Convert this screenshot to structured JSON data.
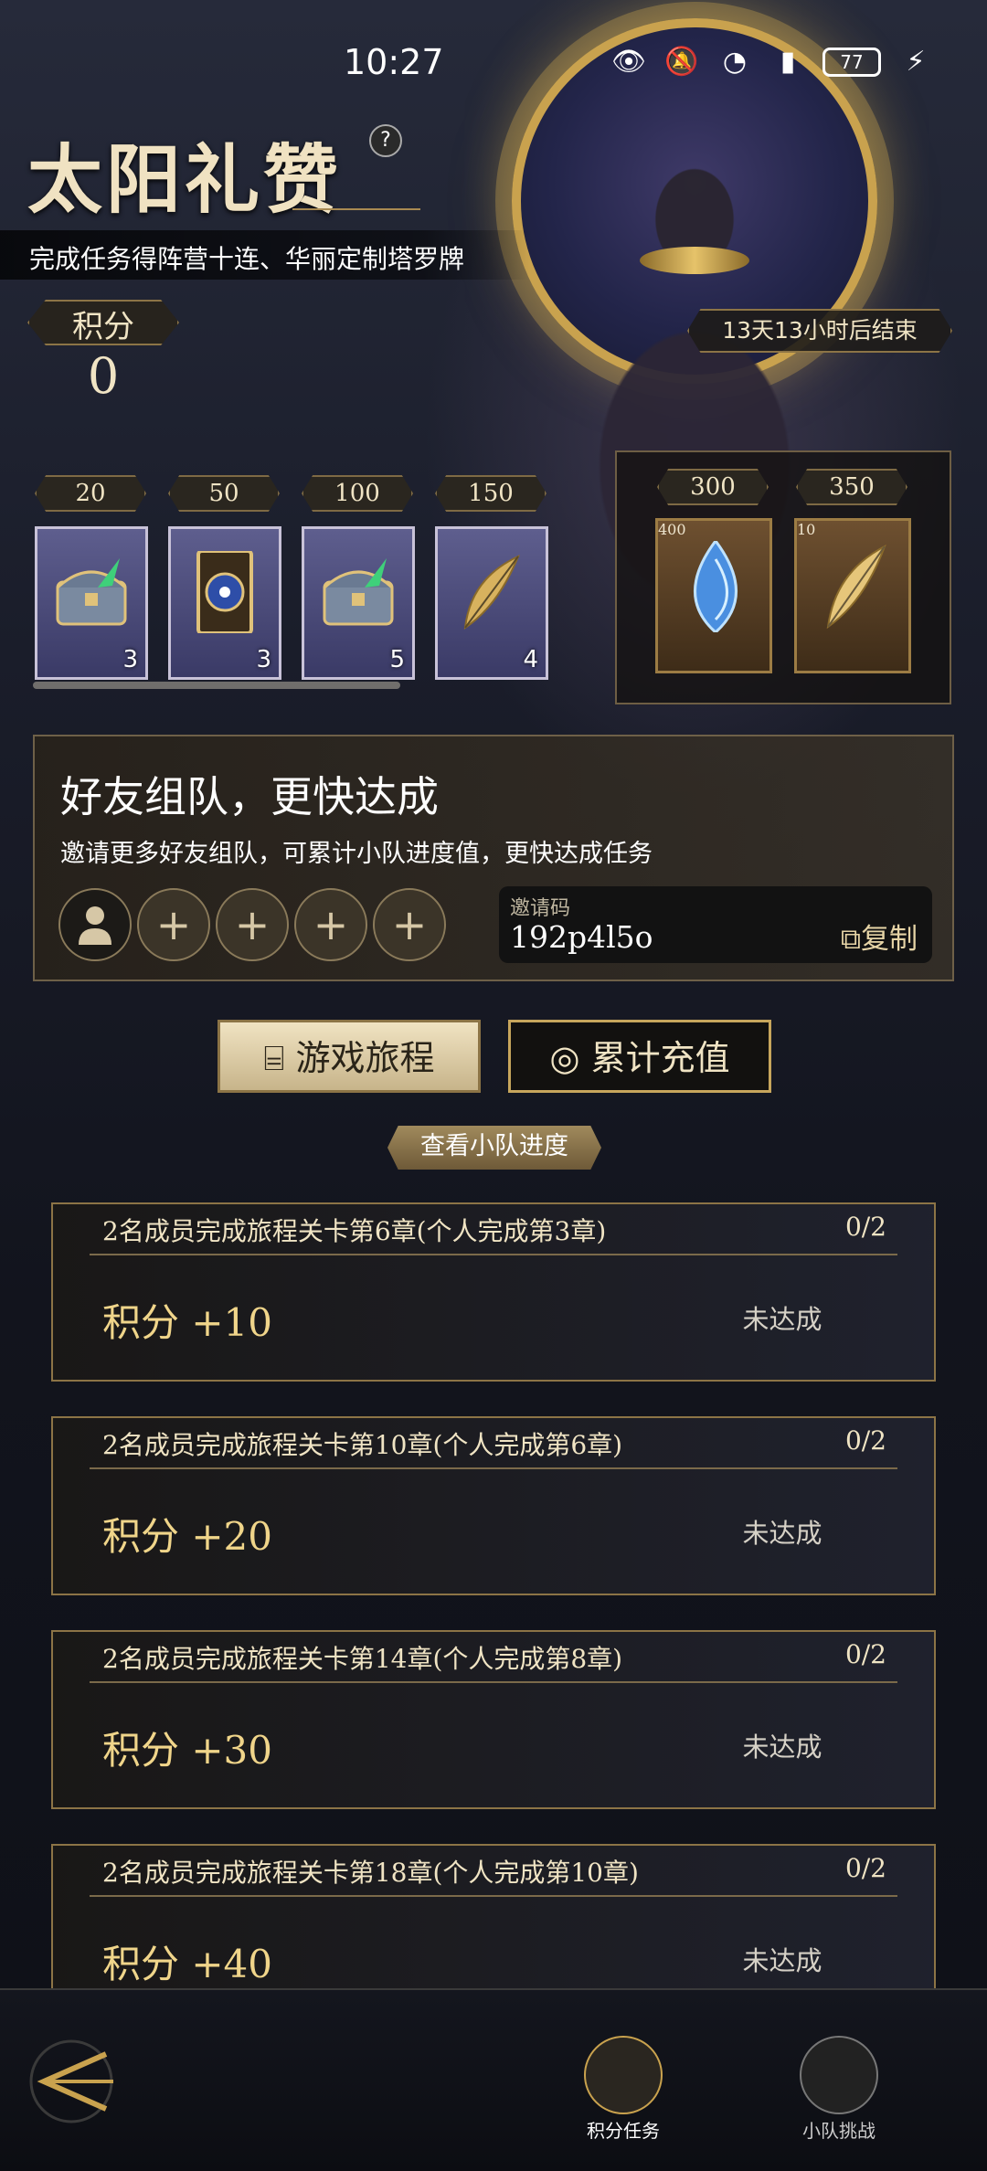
{
  "status_bar": {
    "time": "10:27",
    "battery": "77"
  },
  "header": {
    "title": "太阳礼赞",
    "help": "?",
    "subtitle": "完成任务得阵营十连、华丽定制塔罗牌",
    "points_label": "积分",
    "points_value": "0",
    "timer": "13天13小时后结束"
  },
  "rewards": [
    {
      "milestone": "20",
      "qty": "3",
      "icon": "treasure-chest-icon"
    },
    {
      "milestone": "50",
      "qty": "3",
      "icon": "tarot-card-icon"
    },
    {
      "milestone": "100",
      "qty": "5",
      "icon": "treasure-chest-icon"
    },
    {
      "milestone": "150",
      "qty": "4",
      "icon": "golden-feather-icon"
    }
  ],
  "rewards_special": [
    {
      "milestone": "300",
      "qty": "400",
      "icon": "blue-crystal-icon"
    },
    {
      "milestone": "350",
      "qty": "10",
      "icon": "golden-feather-icon"
    }
  ],
  "team": {
    "title": "好友组队，更快达成",
    "description": "邀请更多好友组队，可累计小队进度值，更快达成任务",
    "slot_plus": "+",
    "invite_label": "邀请码",
    "invite_code": "192p4l5o",
    "copy_label": "复制"
  },
  "tabs": {
    "journey": "游戏旅程",
    "recharge": "累计充值"
  },
  "view_team_progress": "查看小队进度",
  "tasks": [
    {
      "title": "2名成员完成旅程关卡第6章(个人完成第3章)",
      "progress": "0/2",
      "points": "积分 +10",
      "status": "未达成"
    },
    {
      "title": "2名成员完成旅程关卡第10章(个人完成第6章)",
      "progress": "0/2",
      "points": "积分 +20",
      "status": "未达成"
    },
    {
      "title": "2名成员完成旅程关卡第14章(个人完成第8章)",
      "progress": "0/2",
      "points": "积分 +30",
      "status": "未达成"
    },
    {
      "title": "2名成员完成旅程关卡第18章(个人完成第10章)",
      "progress": "0/2",
      "points": "积分 +40",
      "status": "未达成"
    }
  ],
  "nav": {
    "points_tasks": "积分任务",
    "team_challenge": "小队挑战"
  },
  "colors": {
    "gold": "#c9a24e",
    "accent_text": "#f0d58a"
  }
}
